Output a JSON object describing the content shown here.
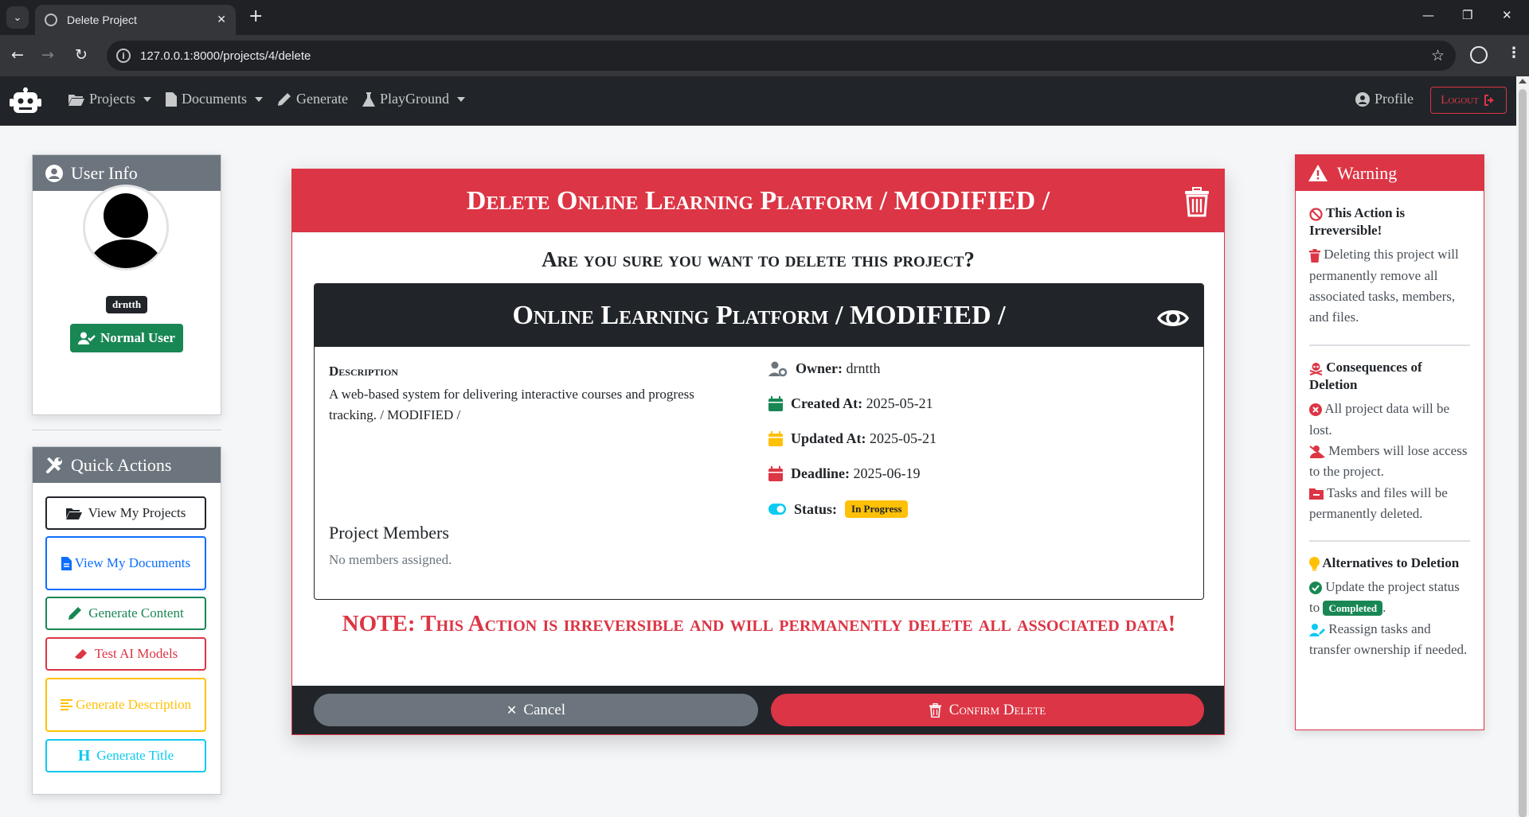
{
  "browser": {
    "tab_title": "Delete Project",
    "url": "127.0.0.1:8000/projects/4/delete"
  },
  "nav": {
    "items": [
      "Projects",
      "Documents",
      "Generate",
      "PlayGround"
    ],
    "profile": "Profile",
    "logout": "Logout"
  },
  "user_info": {
    "title": "User Info",
    "username": "drntth",
    "role": "Normal User"
  },
  "quick_actions": {
    "title": "Quick Actions",
    "items": [
      {
        "label": "View My Projects",
        "color": "#212529"
      },
      {
        "label": "View My Documents",
        "color": "#0d6efd"
      },
      {
        "label": "Generate Content",
        "color": "#198754"
      },
      {
        "label": "Test AI Models",
        "color": "#dc3545"
      },
      {
        "label": "Generate Description",
        "color": "#ffc107"
      },
      {
        "label": "Generate Title",
        "color": "#0dcaf0"
      }
    ]
  },
  "modal": {
    "title": "Delete Online Learning Platform / MODIFIED /",
    "question": "Are you sure you want to delete this project?",
    "project": {
      "name": "Online Learning Platform / MODIFIED /",
      "description_label": "Description",
      "description": "A web-based system for delivering interactive courses and progress tracking. / MODIFIED /",
      "owner_label": "Owner:",
      "owner": "drntth",
      "created_label": "Created At:",
      "created": "2025-05-21",
      "updated_label": "Updated At:",
      "updated": "2025-05-21",
      "deadline_label": "Deadline:",
      "deadline": "2025-06-19",
      "status_label": "Status:",
      "status": "In Progress",
      "members_title": "Project Members",
      "members_text": "No members assigned."
    },
    "note": "NOTE: This Action is irreversible and will permanently delete all associated data!",
    "cancel": "Cancel",
    "confirm": "Confirm Delete"
  },
  "warning": {
    "title": "Warning",
    "s1_title": "This Action is Irreversible!",
    "s1_text": "Deleting this project will permanently remove all associated tasks, members, and files.",
    "s2_title": "Consequences of Deletion",
    "s2_items": [
      "All project data will be lost.",
      "Members will lose access to the project.",
      "Tasks and files will be permanently deleted."
    ],
    "s3_title": "Alternatives to Deletion",
    "s3_item1_pre": "Update the project status to",
    "s3_item1_badge": "Completed",
    "s3_item1_post": ".",
    "s3_item2": "Reassign tasks and transfer ownership if needed."
  },
  "colors": {
    "danger": "#dc3545",
    "dark": "#212529",
    "secondary": "#6c757d",
    "success": "#198754",
    "warning": "#ffc107",
    "info": "#0dcaf0",
    "primary": "#0d6efd"
  }
}
